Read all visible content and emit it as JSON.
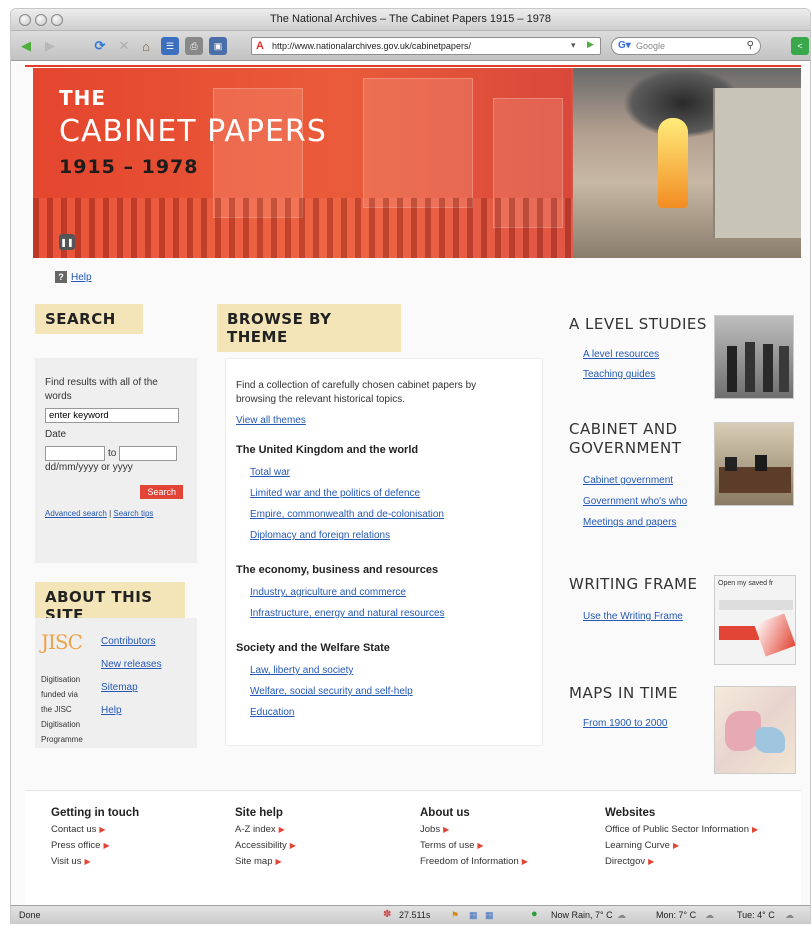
{
  "browser": {
    "window_title": "The National Archives – The Cabinet Papers 1915 – 1978",
    "url": "http://www.nationalarchives.gov.uk/cabinetpapers/",
    "search_placeholder": "Google",
    "status": "Done",
    "status_items": [
      "27.511s",
      "Now Rain, 7° C",
      "Mon: 7° C",
      "Tue: 4° C"
    ]
  },
  "banner": {
    "the": "THE",
    "title": "CABINET PAPERS",
    "years": "1915 – 1978"
  },
  "help_label": "Help",
  "search": {
    "heading": "SEARCH",
    "find_label": "Find results with all of the words",
    "keyword_placeholder": "enter keyword",
    "date_label": "Date",
    "to_label": "to",
    "date_format": "dd/mm/yyyy or yyyy",
    "button": "Search",
    "advanced": "Advanced search",
    "separator": "|",
    "tips": "Search tips"
  },
  "about": {
    "heading": "ABOUT THIS SITE",
    "logo_text": "JISC",
    "digitisation": "Digitisation funded via the JISC Digitisation Programme",
    "links": [
      "Contributors",
      "New releases",
      "Sitemap",
      "Help"
    ]
  },
  "browse": {
    "heading": "BROWSE BY THEME",
    "intro": "Find a collection of carefully chosen cabinet papers by browsing the relevant historical topics.",
    "view_all": "View all themes",
    "sections": [
      {
        "title": "The United Kingdom and the world",
        "links": [
          "Total war",
          "Limited war and the politics of defence",
          "Empire, commonwealth and de-colonisation",
          "Diplomacy and foreign relations"
        ]
      },
      {
        "title": "The economy, business and resources",
        "links": [
          "Industry, agriculture and commerce",
          "Infrastructure, energy and natural resources"
        ]
      },
      {
        "title": "Society and the Welfare State",
        "links": [
          "Law, liberty and society",
          "Welfare, social security and self-help",
          "Education"
        ]
      }
    ]
  },
  "right": {
    "a_level": {
      "heading": "A LEVEL STUDIES",
      "links": [
        "A level resources",
        "Teaching guides"
      ]
    },
    "cabinet": {
      "heading": "CABINET AND GOVERNMENT",
      "links": [
        "Cabinet government",
        "Government who's who",
        "Meetings and papers"
      ]
    },
    "writing": {
      "heading": "WRITING FRAME",
      "links": [
        "Use the Writing Frame"
      ],
      "thumb_text": "Open my saved fr"
    },
    "maps": {
      "heading": "MAPS IN TIME",
      "links": [
        "From 1900 to 2000"
      ]
    }
  },
  "footer": {
    "columns": [
      {
        "title": "Getting in touch",
        "links": [
          "Contact us",
          "Press office",
          "Visit us"
        ]
      },
      {
        "title": "Site help",
        "links": [
          "A-Z index",
          "Accessibility",
          "Site map"
        ]
      },
      {
        "title": "About us",
        "links": [
          "Jobs",
          "Terms of use",
          "Freedom of Information"
        ]
      },
      {
        "title": "Websites",
        "links": [
          "Office of Public Sector Information",
          "Learning Curve",
          "Directgov"
        ]
      }
    ]
  },
  "colors": {
    "accent_red": "#e13d2a",
    "heading_bg": "#f4e5b8",
    "link": "#2659b5"
  }
}
